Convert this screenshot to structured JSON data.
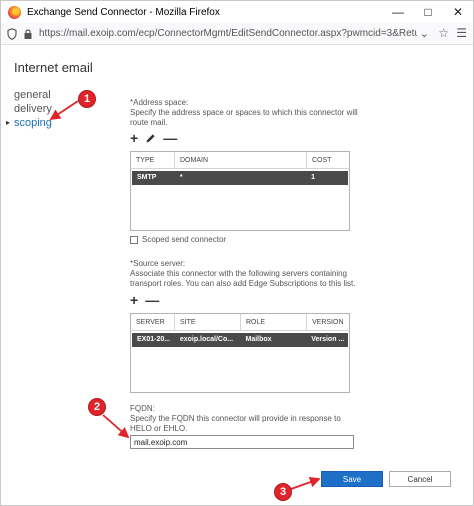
{
  "browser": {
    "window_title": "Exchange Send Connector - Mozilla Firefox",
    "url": "https://mail.exoip.com/ecp/ConnectorMgmt/EditSendConnector.aspx?pwmcid=3&ReturnObj",
    "icons": [
      "firefox-icon",
      "shield-icon",
      "lock-icon",
      "chevron-down-icon",
      "star-icon",
      "menu-icon",
      "minimize-icon",
      "maximize-icon",
      "close-icon"
    ]
  },
  "page": {
    "title": "Internet email",
    "nav": [
      {
        "label": "general"
      },
      {
        "label": "delivery"
      },
      {
        "label": "scoping",
        "active": true
      }
    ],
    "address_space": {
      "heading": "*Address space:",
      "description": "Specify the address space or spaces to which this connector will route mail.",
      "columns": [
        "TYPE",
        "DOMAIN",
        "COST"
      ],
      "rows": [
        [
          "SMTP",
          "*",
          "1"
        ]
      ]
    },
    "scoped_label": "Scoped send connector",
    "source_server": {
      "heading": "*Source server:",
      "description": "Associate this connector with the following servers containing transport roles. You can also add Edge Subscriptions to this list.",
      "columns": [
        "SERVER",
        "SITE",
        "ROLE",
        "VERSION"
      ],
      "rows": [
        [
          "EX01-20...",
          "exoip.local/Co...",
          "Mailbox",
          "Version ..."
        ]
      ]
    },
    "fqdn": {
      "heading": "FQDN:",
      "description": "Specify the FQDN this connector will provide in response to HELO or EHLO.",
      "value": "mail.exoip.com"
    },
    "save_label": "Save",
    "cancel_label": "Cancel"
  },
  "callouts": [
    "1",
    "2",
    "3"
  ],
  "colors": {
    "accent": "#1e6fc8",
    "link": "#1e6eb4",
    "callout": "#e0242a",
    "selected_row": "#4a4a4a"
  }
}
